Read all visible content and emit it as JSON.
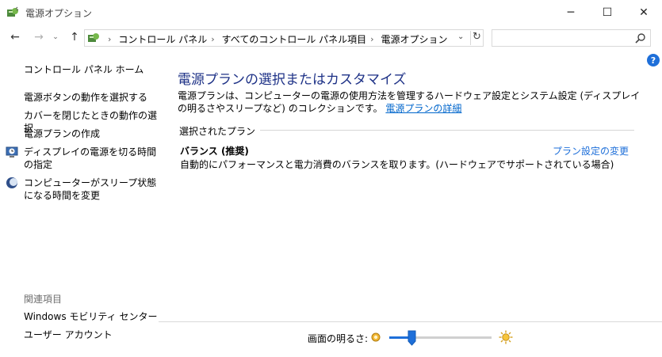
{
  "window": {
    "title": "電源オプション",
    "minimize_glyph": "─",
    "maximize_glyph": "☐",
    "close_glyph": "✕"
  },
  "nav": {
    "back_glyph": "←",
    "forward_glyph": "→",
    "history_glyph": "⌄",
    "up_glyph": "↑",
    "breadcrumbs": [
      "コントロール パネル",
      "すべてのコントロール パネル項目",
      "電源オプション"
    ],
    "breadcrumb_sep": "›",
    "dropdown_glyph": "⌄",
    "refresh_glyph": "↻",
    "search_placeholder": ""
  },
  "help_label": "?",
  "sidebar": {
    "home": "コントロール パネル ホーム",
    "links": [
      "電源ボタンの動作を選択する",
      "カバーを閉じたときの動作の選択",
      "電源プランの作成",
      "ディスプレイの電源を切る時間の指定",
      "コンピューターがスリープ状態になる時間を変更"
    ],
    "see_also": "関連項目",
    "see_also_links": [
      "Windows モビリティ センター",
      "ユーザー アカウント"
    ]
  },
  "main": {
    "heading": "電源プランの選択またはカスタマイズ",
    "description": "電源プランは、コンピューターの電源の使用方法を管理するハードウェア設定とシステム設定 (ディスプレイの明るさやスリープなど) のコレクションです。",
    "description_link": "電源プランの詳細",
    "group_label": "選択されたプラン",
    "plan": {
      "name": "バランス (推奨)",
      "change_link": "プラン設定の変更",
      "description": "自動的にパフォーマンスと電力消費のバランスを取ります。(ハードウェアでサポートされている場合)"
    }
  },
  "bottom": {
    "brightness_label": "画面の明るさ:",
    "brightness_value": 0.22
  },
  "colors": {
    "heading": "#1e3287",
    "link": "#0066cc",
    "accent": "#1e6fd9"
  },
  "icons": {
    "app": "power-options-icon",
    "display_link": "display-clock-icon",
    "sleep_link": "moon-icon",
    "dim": "sun-dim-icon",
    "bright": "sun-bright-icon",
    "search": "search-icon"
  }
}
